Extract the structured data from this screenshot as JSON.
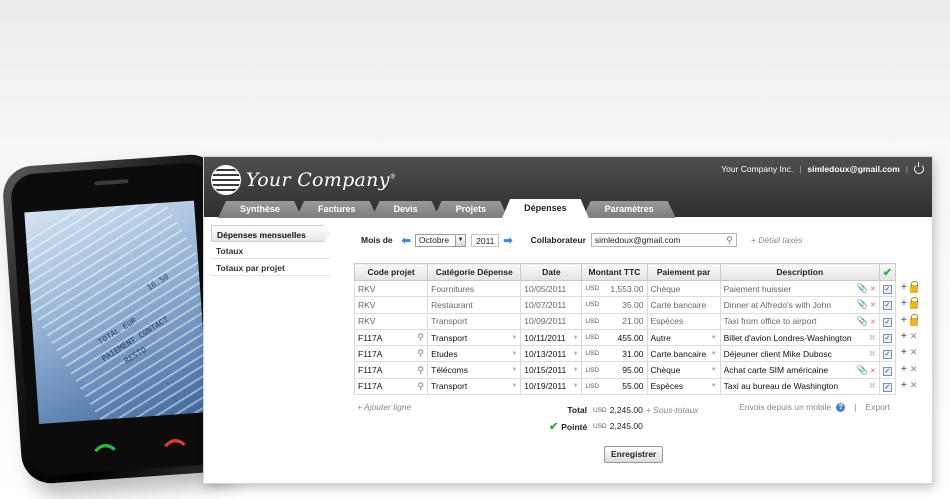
{
  "header": {
    "logo_text": "Your Company",
    "logo_mark": "®",
    "company_name": "Your Company Inc.",
    "separator": "|",
    "user_email": "simledoux@gmail.com"
  },
  "tabs": [
    {
      "label": "Synthèse"
    },
    {
      "label": "Factures"
    },
    {
      "label": "Devis"
    },
    {
      "label": "Projets"
    },
    {
      "label": "Dépenses",
      "active": true
    },
    {
      "label": "Paramètres"
    }
  ],
  "sidebar": {
    "items": [
      {
        "label": "Dépenses mensuelles",
        "active": true
      },
      {
        "label": "Totaux"
      },
      {
        "label": "Totaux par projet"
      }
    ]
  },
  "filters": {
    "month_label": "Mois de",
    "month_value": "Octobre",
    "year_value": "2011",
    "collab_label": "Collaborateur",
    "collab_value": "simledoux@gmail.com",
    "detail_link": "+ Détail taxes"
  },
  "table": {
    "headers": [
      "Code projet",
      "Catégorie Dépense",
      "Date",
      "Montant TTC",
      "Paiement par",
      "Description"
    ],
    "rows": [
      {
        "code": "RKV",
        "category": "Fournitures",
        "date": "10/05/2011",
        "currency": "USD",
        "amount": "1,553.00",
        "payment": "Chèque",
        "description": "Paiement huissier",
        "locked": true
      },
      {
        "code": "RKV",
        "category": "Restaurant",
        "date": "10/07/2011",
        "currency": "USD",
        "amount": "35.00",
        "payment": "Carte bancaire",
        "description": "Dinner at Alfredo's with John",
        "locked": true
      },
      {
        "code": "RKV",
        "category": "Transport",
        "date": "10/09/2011",
        "currency": "USD",
        "amount": "21.00",
        "payment": "Espèces",
        "description": "Taxi from office to airport",
        "locked": true
      },
      {
        "code": "F117A",
        "category": "Transport",
        "date": "10/11/2011",
        "currency": "USD",
        "amount": "455.00",
        "payment": "Autre",
        "description": "Billet d'avion Londres-Washington",
        "locked": false
      },
      {
        "code": "F117A",
        "category": "Etudes",
        "date": "10/13/2011",
        "currency": "USD",
        "amount": "31.00",
        "payment": "Carte bancaire",
        "description": "Déjeuner client Mike Dubosc",
        "locked": false
      },
      {
        "code": "F117A",
        "category": "Télécoms",
        "date": "10/15/2011",
        "currency": "USD",
        "amount": "95.00",
        "payment": "Chèque",
        "description": "Achat carte SIM américaine",
        "locked": false
      },
      {
        "code": "F117A",
        "category": "Transport",
        "date": "10/19/2011",
        "currency": "USD",
        "amount": "55.00",
        "payment": "Espèces",
        "description": "Taxi au bureau de Washington",
        "locked": false
      }
    ]
  },
  "footer": {
    "add_line": "+ Ajouter ligne",
    "total_label": "Total",
    "total_currency": "USD",
    "total_value": "2,245.00",
    "subtotals_link": "+ Sous-totaux",
    "pointe_label": "Pointé",
    "pointe_currency": "USD",
    "pointe_value": "2,245.00",
    "mobile_link": "Envois depuis un mobile",
    "help_glyph": "?",
    "separator": "|",
    "export_link": "Export",
    "save_label": "Enregistrer"
  },
  "phone": {
    "receipt_lines": [
      "TOTAL EUR",
      "PAIEMENT CONTACT",
      "RESTO",
      "16.50"
    ]
  },
  "colors": {
    "header_dark": "#2e2e2e",
    "tab_grey": "#8a8a8a",
    "link_blue": "#3b87d6",
    "check_green": "#3aa543",
    "lock_gold": "#e6b52c"
  }
}
